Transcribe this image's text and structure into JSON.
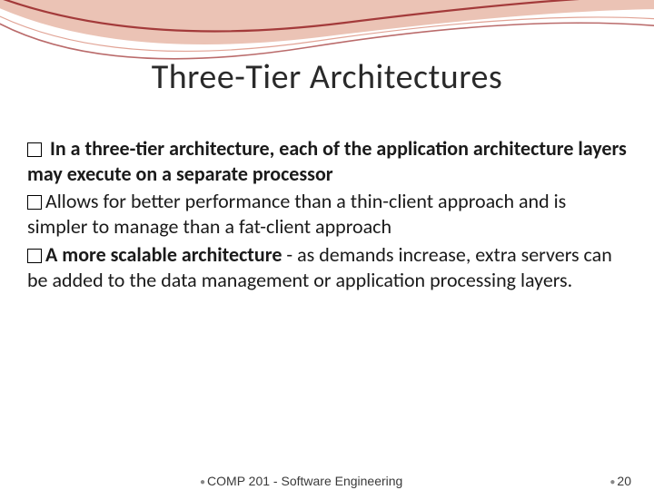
{
  "title": "Three-Tier Architectures",
  "bullets": [
    {
      "prefix_bold": " In a three-tier architecture, each of the application architecture layers may execute on a separate processor",
      "rest": ""
    },
    {
      "prefix_bold": "",
      "rest": "Allows for better performance than a thin-client approach and is simpler to manage than a fat-client approach"
    },
    {
      "prefix_bold": "A more scalable architecture",
      "rest": " - as demands increase, extra servers can be added to the data management or application processing layers."
    }
  ],
  "footer": {
    "course": "COMP 201 - Software Engineering",
    "page": "20"
  },
  "colors": {
    "curve_dark": "#a33a3a",
    "curve_light": "#e8b8a8"
  }
}
